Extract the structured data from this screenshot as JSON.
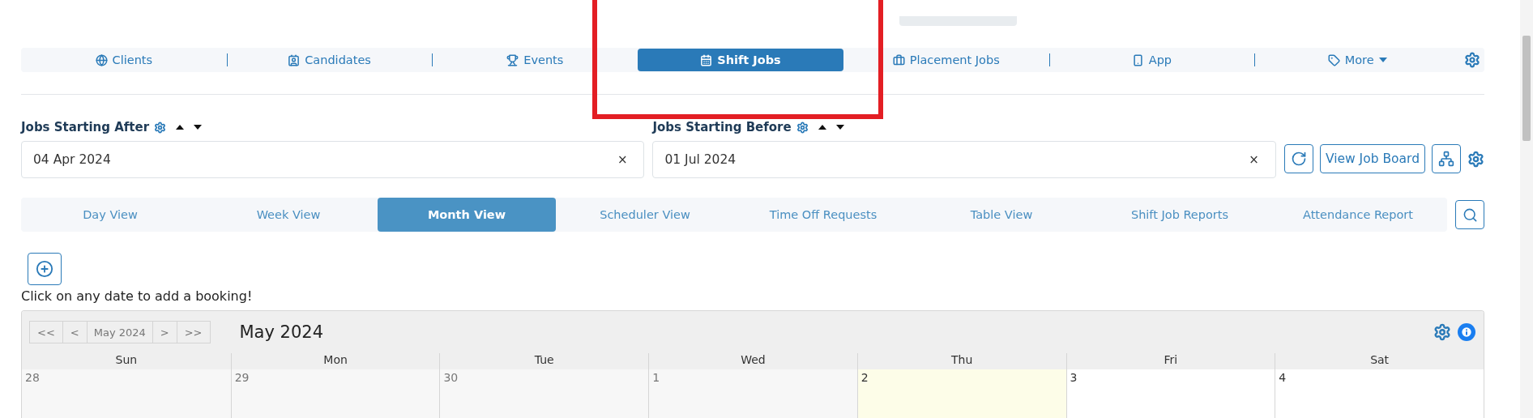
{
  "nav": {
    "items": [
      {
        "label": "Clients",
        "selected": false,
        "dropdown": false
      },
      {
        "label": "Candidates",
        "selected": false,
        "dropdown": false
      },
      {
        "label": "Events",
        "selected": false,
        "dropdown": false
      },
      {
        "label": "Shift Jobs",
        "selected": true,
        "dropdown": false
      },
      {
        "label": "Placement Jobs",
        "selected": false,
        "dropdown": false
      },
      {
        "label": "App",
        "selected": false,
        "dropdown": false
      },
      {
        "label": "More",
        "selected": false,
        "dropdown": true
      }
    ]
  },
  "filters": [
    {
      "label": "Jobs Starting After",
      "value": "04 Apr 2024",
      "clear": "×"
    },
    {
      "label": "Jobs Starting Before",
      "value": "01 Jul 2024",
      "clear": "×"
    }
  ],
  "view_job_board": "View Job Board",
  "view_tabs": [
    {
      "label": "Day View",
      "selected": false
    },
    {
      "label": "Week View",
      "selected": false
    },
    {
      "label": "Month View",
      "selected": true
    },
    {
      "label": "Scheduler View",
      "selected": false
    },
    {
      "label": "Time Off Requests",
      "selected": false
    },
    {
      "label": "Table View",
      "selected": false
    },
    {
      "label": "Shift Job Reports",
      "selected": false
    },
    {
      "label": "Attendance Report",
      "selected": false
    }
  ],
  "hint": "Click on any date to add a booking!",
  "calendar": {
    "nav_buttons": [
      {
        "label": "<<",
        "kind": "arrow"
      },
      {
        "label": "<",
        "kind": "arrow"
      },
      {
        "label": "May 2024",
        "kind": "current"
      },
      {
        "label": ">",
        "kind": "arrow"
      },
      {
        "label": ">>",
        "kind": "arrow"
      }
    ],
    "title": "May 2024",
    "weekdays": [
      "Sun",
      "Mon",
      "Tue",
      "Wed",
      "Thu",
      "Fri",
      "Sat"
    ],
    "days": [
      {
        "number": "28",
        "past": true,
        "today": false
      },
      {
        "number": "29",
        "past": true,
        "today": false
      },
      {
        "number": "30",
        "past": true,
        "today": false
      },
      {
        "number": "1",
        "past": true,
        "today": false
      },
      {
        "number": "2",
        "past": false,
        "today": true
      },
      {
        "number": "3",
        "past": false,
        "today": false
      },
      {
        "number": "4",
        "past": false,
        "today": false
      }
    ]
  }
}
